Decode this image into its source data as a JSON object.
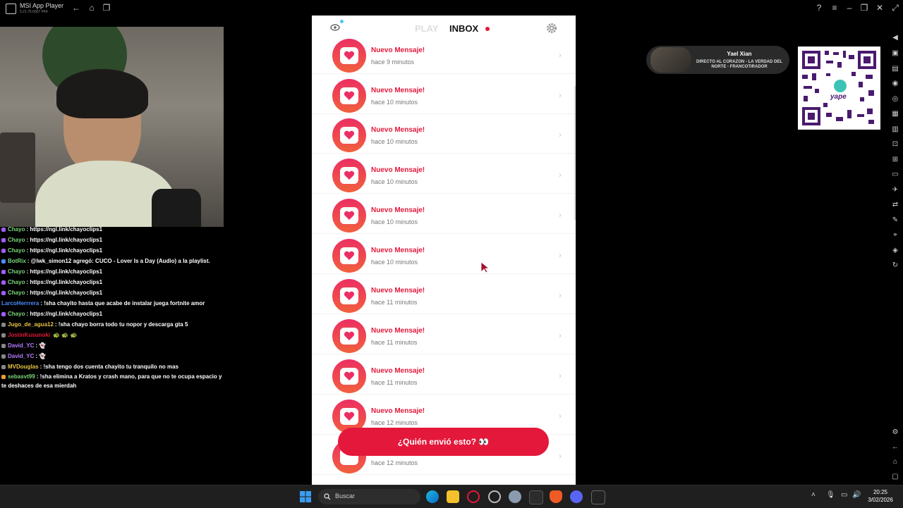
{
  "window": {
    "title": "MSI App Player",
    "subtitle": "5.21.75.6007 P64"
  },
  "chat": [
    {
      "user": "Chayo",
      "user_color": "#7dd87d",
      "badge_color": "#a35cff",
      "text": ": https://ngl.link/chayoclips1"
    },
    {
      "user": "Chayo",
      "user_color": "#7dd87d",
      "badge_color": "#a35cff",
      "text": ": https://ngl.link/chayoclips1"
    },
    {
      "user": "Chayo",
      "user_color": "#7dd87d",
      "badge_color": "#a35cff",
      "text": ": https://ngl.link/chayoclips1"
    },
    {
      "user": "BotRix",
      "user_color": "#7dd87d",
      "badge_color": "#4a8cff",
      "text": ": @lwk_simon12 agregó: CUCO - Lover Is a Day (Audio) a la playlist."
    },
    {
      "user": "Chayo",
      "user_color": "#7dd87d",
      "badge_color": "#a35cff",
      "text": ": https://ngl.link/chayoclips1"
    },
    {
      "user": "Chayo",
      "user_color": "#7dd87d",
      "badge_color": "#a35cff",
      "text": ": https://ngl.link/chayoclips1"
    },
    {
      "user": "Chayo",
      "user_color": "#7dd87d",
      "badge_color": "#a35cff",
      "text": ": https://ngl.link/chayoclips1"
    },
    {
      "user": "LarcoHerrrera",
      "user_color": "#4a8cff",
      "badge_color": "",
      "text": ": !sha chayito hasta que acabe de instalar juega fortnite amor"
    },
    {
      "user": "Chayo",
      "user_color": "#7dd87d",
      "badge_color": "#a35cff",
      "text": ": https://ngl.link/chayoclips1"
    },
    {
      "user": "Jugo_de_agua12",
      "user_color": "#e8c547",
      "badge_color": "#888888",
      "text": ": !sha chayo borra todo tu nopor y descarga gta 5"
    },
    {
      "user": "JostinKusunoki",
      "user_color": "#e3183a",
      "badge_color": "#888888",
      "text": ""
    },
    {
      "user": "David_YC",
      "user_color": "#b77dff",
      "badge_color": "#888888",
      "text": ":"
    },
    {
      "user": "David_YC",
      "user_color": "#b77dff",
      "badge_color": "#888888",
      "text": ":"
    },
    {
      "user": "MVDouglas",
      "user_color": "#e8c547",
      "badge_color": "#888888",
      "text": ": !sha tengo dos cuenta chayito tu tranquilo no mas"
    },
    {
      "user": "sebasvt99",
      "user_color": "#7dd87d",
      "badge_color": "#e8a030",
      "text": ": !sha elimina a Kratos y crash mano, para que no te ocupa espacio y te deshaces de esa mierdah"
    }
  ],
  "phone": {
    "tabs": {
      "play": "PLAY",
      "inbox": "INBOX"
    },
    "messages": [
      {
        "title": "Nuevo Mensaje!",
        "time": "hace 9 minutos"
      },
      {
        "title": "Nuevo Mensaje!",
        "time": "hace 10 minutos"
      },
      {
        "title": "Nuevo Mensaje!",
        "time": "hace 10 minutos"
      },
      {
        "title": "Nuevo Mensaje!",
        "time": "hace 10 minutos"
      },
      {
        "title": "Nuevo Mensaje!",
        "time": "hace 10 minutos"
      },
      {
        "title": "Nuevo Mensaje!",
        "time": "hace 10 minutos"
      },
      {
        "title": "Nuevo Mensaje!",
        "time": "hace 11 minutos"
      },
      {
        "title": "Nuevo Mensaje!",
        "time": "hace 11 minutos"
      },
      {
        "title": "Nuevo Mensaje!",
        "time": "hace 11 minutos"
      },
      {
        "title": "Nuevo Mensaje!",
        "time": "hace 12 minutos"
      },
      {
        "title": "",
        "time": "hace 12 minutos"
      }
    ],
    "cta_label": "¿Quién envió esto? 👀",
    "accent": "#e3183a"
  },
  "overlay": {
    "name": "Yael Xian",
    "song": "DIRECTO AL CORAZON - LA VERDAD DEL NORTE - FRANCOTIRADOR",
    "qr_label": "yape"
  },
  "taskbar": {
    "search_placeholder": "Buscar",
    "time": "20:25",
    "date": "3/02/2026"
  }
}
